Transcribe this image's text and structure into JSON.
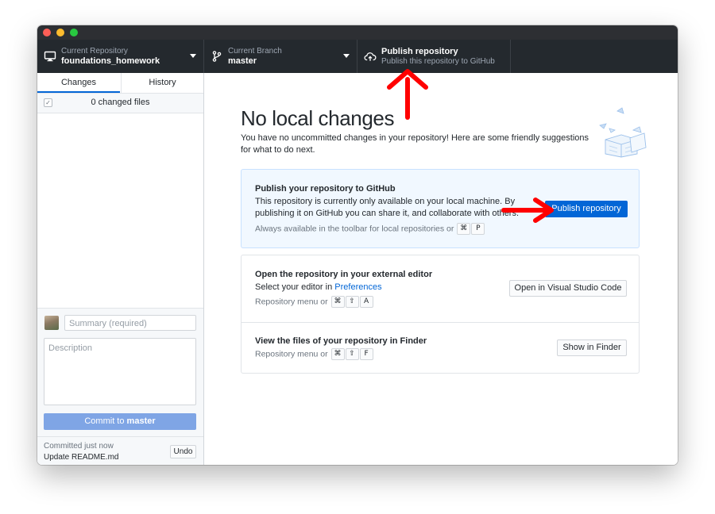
{
  "toolbar": {
    "repo_label": "Current Repository",
    "repo_name": "foundations_homework",
    "branch_label": "Current Branch",
    "branch_name": "master",
    "publish_title": "Publish repository",
    "publish_subtitle": "Publish this repository to GitHub"
  },
  "sidebar": {
    "tabs": [
      {
        "label": "Changes",
        "active": true
      },
      {
        "label": "History",
        "active": false
      }
    ],
    "changed_files": "0 changed files",
    "summary_placeholder": "Summary (required)",
    "description_placeholder": "Description",
    "commit_prefix": "Commit to ",
    "commit_branch": "master",
    "last_commit_when": "Committed just now",
    "last_commit_message": "Update README.md",
    "undo_label": "Undo"
  },
  "main": {
    "title": "No local changes",
    "intro": "You have no uncommitted changes in your repository! Here are some friendly suggestions for what to do next.",
    "publish_card": {
      "title": "Publish your repository to GitHub",
      "text": "This repository is currently only available on your local machine. By publishing it on GitHub you can share it, and collaborate with others.",
      "hint": "Always available in the toolbar for local repositories or",
      "keys": [
        "⌘",
        "P"
      ],
      "button": "Publish repository"
    },
    "editor_row": {
      "title": "Open the repository in your external editor",
      "text_prefix": "Select your editor in ",
      "link": "Preferences",
      "hint": "Repository menu or",
      "keys": [
        "⌘",
        "⇧",
        "A"
      ],
      "button": "Open in Visual Studio Code"
    },
    "finder_row": {
      "title": "View the files of your repository in Finder",
      "hint": "Repository menu or",
      "keys": [
        "⌘",
        "⇧",
        "F"
      ],
      "button": "Show in Finder"
    }
  },
  "colors": {
    "toolbar_bg": "#24292e",
    "accent": "#0366d6",
    "annotation_arrow": "#ff0000"
  }
}
